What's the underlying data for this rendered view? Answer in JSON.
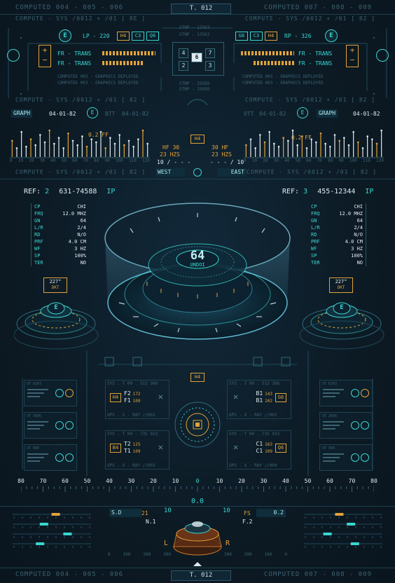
{
  "header": {
    "left": "COMPUTED 004 - 005 - 006",
    "center": "T. 012",
    "right": "COMPUTED 007 - 008 - 009"
  },
  "subheader": {
    "left": "COMPUTE - SYS /0012 + /01 [ 8E ]",
    "right": "COMPUTE - SYS /0012 + /01 [ 82 ]"
  },
  "topleft": {
    "badge": "E",
    "lp": "LP - 220",
    "tags": [
      "H4",
      "C3",
      "Q6"
    ],
    "rows": [
      "FR - TRANS",
      "FR - TRANS"
    ],
    "notes": [
      "COMPUTED 003 - GRAPHICS DEPLOYED",
      "COMPUTED 003 - GRAPHICS DEPLOYED"
    ]
  },
  "topright": {
    "badge": "E",
    "rp": "RP - 326",
    "tags": [
      "G6",
      "C3",
      "H4"
    ],
    "rows": [
      "FR - TRANS",
      "FR - TRANS"
    ],
    "notes": [
      "COMPUTED 003 - GRAPHICS DEPLOYED",
      "COMPUTED 003 - GRAPHICS DEPLOYED"
    ]
  },
  "center_top": {
    "labels": [
      "STNP - 13563",
      "STNP - 13563",
      "STNP - 15GEO",
      "STNP - 15GEO"
    ],
    "grid": [
      "4",
      "6",
      "7",
      "2",
      "3"
    ]
  },
  "row_mid": {
    "subheader_left": "COMPUTE - SYS /0012 + /01 [ 82 ]",
    "subheader_right": "COMPUTE - SYS /0012 + /01 [ 82 ]",
    "graph_left": "GRAPH",
    "date_left": "04-01-82",
    "btt": "BTT",
    "date_left2": "04-01-82",
    "graph_right": "GRAPH",
    "date_right": "04-01-82",
    "ott": "OTT",
    "date_right2": "04-01-82"
  },
  "eq_left": {
    "ticks": [
      "0",
      "10",
      "20",
      "30",
      "40",
      "50",
      "60",
      "70",
      "80",
      "90",
      "100",
      "110",
      "120"
    ],
    "ff": "0.2 FF",
    "values": [
      0.55,
      0.3,
      0.85,
      0.35,
      0.6,
      0.4,
      0.75,
      0.5,
      0.9,
      0.45,
      0.65,
      0.3,
      0.8,
      0.55,
      0.4,
      0.7,
      0.35,
      0.6,
      0.5,
      0.85,
      0.3,
      0.65,
      0.45,
      0.75,
      0.4,
      0.55,
      0.35,
      0.6,
      0.9,
      0.45
    ]
  },
  "eq_right": {
    "ticks": [
      "0",
      "10",
      "20",
      "30",
      "40",
      "50",
      "60",
      "70",
      "80",
      "90",
      "100",
      "110",
      "120"
    ],
    "ff": "0.2 FF",
    "values": [
      0.4,
      0.6,
      0.3,
      0.75,
      0.5,
      0.85,
      0.45,
      0.35,
      0.65,
      0.55,
      0.9,
      0.4,
      0.7,
      0.3,
      0.6,
      0.5,
      0.8,
      0.45,
      0.35,
      0.75,
      0.55,
      0.65,
      0.4,
      0.85,
      0.5,
      0.3,
      0.7,
      0.6,
      0.45,
      0.9
    ]
  },
  "center_mid": {
    "tag": "H4",
    "hf_left": "HF 30",
    "hzs_left": "23 HZS",
    "frac_left": "10 / - - -",
    "hf_right": "30 HF",
    "hzs_right": "23 HZS",
    "frac_right": "- - - / 10",
    "west": "WEST",
    "east": "EAST"
  },
  "subheader3": {
    "left": "COMPUTE - SYS /0012 + /01 [ 82 ]",
    "right": "COMPUTE - SYS /0012 + /01 [ 82 ]"
  },
  "ref_left": {
    "label": "REF:",
    "num": "2",
    "code": "631-74588",
    "ip": "IP"
  },
  "ref_right": {
    "label": "REF:",
    "num": "3",
    "code": "455-12344",
    "ip": "IP"
  },
  "specs_left": [
    {
      "k": "CP",
      "v": "CHI"
    },
    {
      "k": "FRQ",
      "v": "12.0 MHZ"
    },
    {
      "k": "GN",
      "v": "64"
    },
    {
      "k": "L/R",
      "v": "2/4"
    },
    {
      "k": "RD",
      "v": "N/O"
    },
    {
      "k": "PRF",
      "v": "4.0 CM"
    },
    {
      "k": "WF",
      "v": "3 HZ"
    },
    {
      "k": "SP",
      "v": "100%"
    },
    {
      "k": "TER",
      "v": "NO"
    }
  ],
  "specs_right": [
    {
      "k": "CP",
      "v": "CHI"
    },
    {
      "k": "FRQ",
      "v": "12.0 MHZ"
    },
    {
      "k": "GN",
      "v": "64"
    },
    {
      "k": "L/R",
      "v": "2/4"
    },
    {
      "k": "RD",
      "v": "N/O"
    },
    {
      "k": "PRF",
      "v": "4.0 CM"
    },
    {
      "k": "WF",
      "v": "3 HZ"
    },
    {
      "k": "SP",
      "v": "100%"
    },
    {
      "k": "TER",
      "v": "NO"
    }
  ],
  "core": {
    "number": "64",
    "sub": "UNDOI"
  },
  "dkt_left": {
    "value": "227",
    "unit": "DKT"
  },
  "dkt_right": {
    "value": "227",
    "unit": "DKT"
  },
  "side_badge_left": "E",
  "side_badge_right": "E",
  "lower": {
    "tag": "H4",
    "panels": [
      {
        "hdr": "SYS . T 00 . 512 366",
        "t1": "H4",
        "t2": "F2",
        "t3": "F1",
        "n1": "172",
        "n2": "109",
        "foot": "OPS . X - RAY //001"
      },
      {
        "hdr": "SYS . T 00 . 512 366",
        "t1": "G6",
        "t2": "B1",
        "t3": "B1",
        "n1": "143",
        "n2": "102",
        "foot": "OPS . X - RAY //002"
      },
      {
        "hdr": "SYS . T 00 . 735 933",
        "t1": "B4",
        "t2": "T2",
        "t3": "T1",
        "n1": "125",
        "n2": "109",
        "foot": "OPS . X - RAY //003"
      },
      {
        "hdr": "SYS . T 00 . 735 933",
        "t1": "Q6",
        "t2": "C1",
        "t3": "C1",
        "n1": "163",
        "n2": "109",
        "foot": "OPS . X - RAY //004"
      }
    ],
    "mini_left": [
      "UT 6263",
      "UT 3606",
      "UT 990"
    ],
    "mini_right": [
      "UT 6263",
      "UT 3606",
      "UT 990"
    ]
  },
  "scale": {
    "labels": [
      "80",
      "70",
      "60",
      "50",
      "40",
      "30",
      "20",
      "10",
      "0",
      "10",
      "20",
      "30",
      "40",
      "50",
      "60",
      "70",
      "80"
    ],
    "readout": "0.0"
  },
  "bottom": {
    "sd": "S.D",
    "sd_val": "21",
    "fs": "FS",
    "fs_val": "0.2",
    "n1": "N.1",
    "f2": "F.2",
    "ten_left": "10",
    "ten_right": "10",
    "l": "L",
    "r": "R",
    "ticks_left": [
      "0",
      "100",
      "200",
      "300"
    ],
    "ticks_right": [
      "300",
      "200",
      "100",
      "0"
    ]
  },
  "footer": {
    "left": "COMPUTED 004 - 005 - 006",
    "center": "T. 012",
    "right": "COMPUTED 007 - 008 - 009"
  },
  "colors": {
    "cyan": "#3ad6d0",
    "amber": "#e2a33a",
    "bg": "#0c1a24",
    "line": "#1d4050"
  }
}
